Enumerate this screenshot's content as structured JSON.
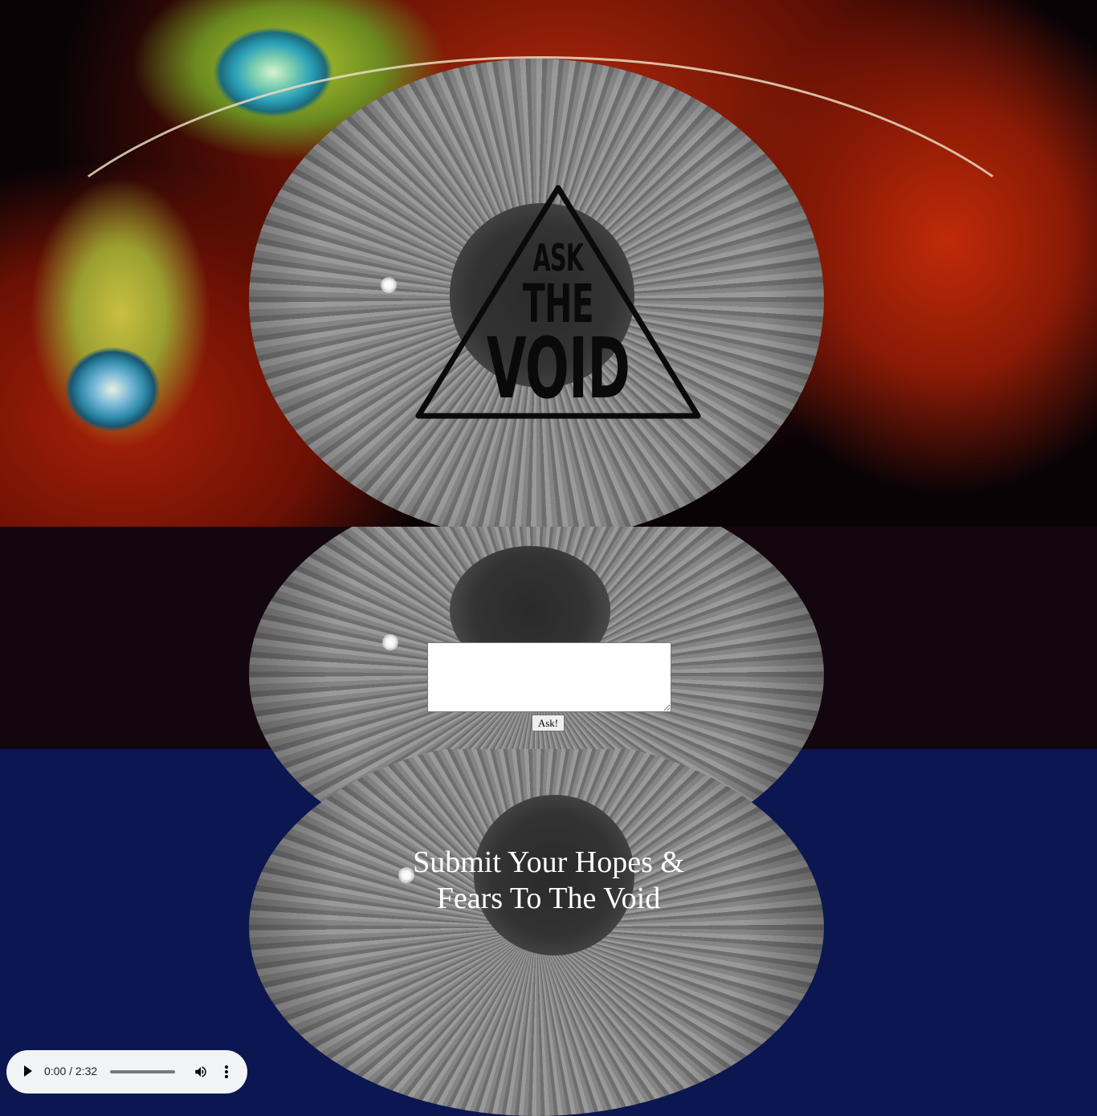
{
  "logo": {
    "line1": "ASK",
    "line2": "THE",
    "line3": "VOID"
  },
  "question_form": {
    "input_value": "",
    "submit_label": "Ask!"
  },
  "tagline": "Submit Your Hopes & Fears To The Void",
  "audio_player": {
    "time_display": "0:00 / 2:32",
    "play_icon": "play-icon",
    "volume_icon": "volume-icon",
    "menu_icon": "more-options-icon",
    "progress": 0
  },
  "colors": {
    "tagline_text": "#ffffff",
    "logo_ink": "#0a0a0a",
    "player_background": "#f1f3f4"
  }
}
